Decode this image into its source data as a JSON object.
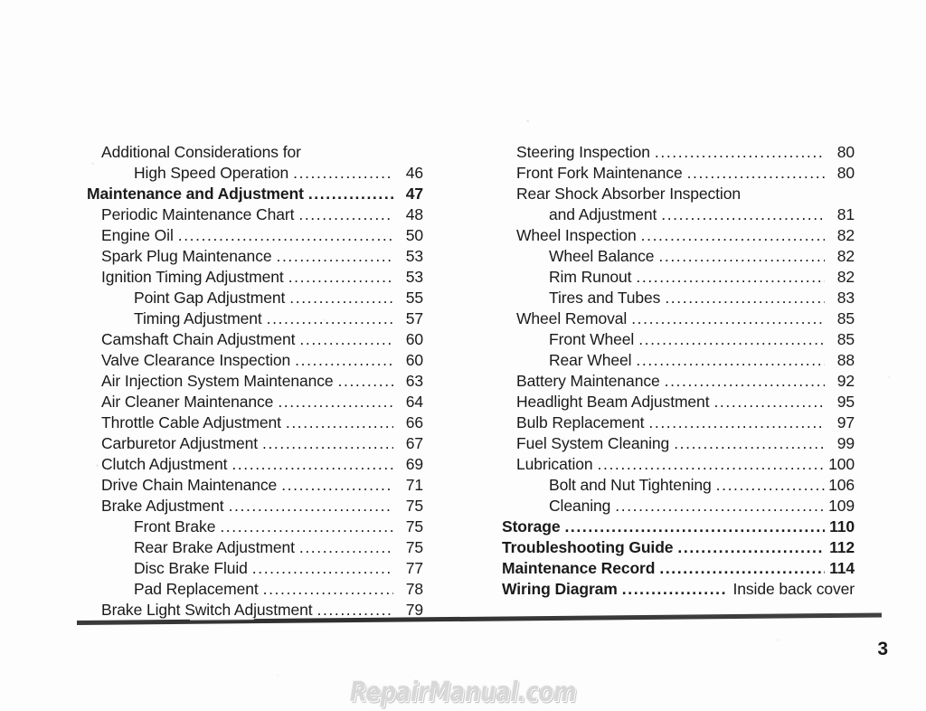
{
  "document": {
    "page_number": "3",
    "watermark": "RepairManual.com"
  },
  "toc": {
    "left_column": [
      {
        "label": "Additional Considerations for",
        "page": "",
        "level": 1,
        "leader": false
      },
      {
        "label": "High Speed Operation",
        "page": "46",
        "level": 2,
        "leader": true
      },
      {
        "label": "Maintenance and Adjustment",
        "page": "47",
        "level": 0,
        "leader": true
      },
      {
        "label": "Periodic Maintenance Chart",
        "page": "48",
        "level": 1,
        "leader": true
      },
      {
        "label": "Engine Oil",
        "page": "50",
        "level": 1,
        "leader": true
      },
      {
        "label": "Spark Plug Maintenance",
        "page": "53",
        "level": 1,
        "leader": true
      },
      {
        "label": "Ignition Timing Adjustment",
        "page": "53",
        "level": 1,
        "leader": true
      },
      {
        "label": "Point Gap Adjustment",
        "page": "55",
        "level": 2,
        "leader": true
      },
      {
        "label": "Timing Adjustment",
        "page": "57",
        "level": 2,
        "leader": true
      },
      {
        "label": "Camshaft Chain Adjustment",
        "page": "60",
        "level": 1,
        "leader": true
      },
      {
        "label": "Valve Clearance Inspection",
        "page": "60",
        "level": 1,
        "leader": true
      },
      {
        "label": "Air Injection System Maintenance",
        "page": "63",
        "level": 1,
        "leader": true
      },
      {
        "label": "Air Cleaner Maintenance",
        "page": "64",
        "level": 1,
        "leader": true
      },
      {
        "label": "Throttle Cable Adjustment",
        "page": "66",
        "level": 1,
        "leader": true
      },
      {
        "label": "Carburetor Adjustment",
        "page": "67",
        "level": 1,
        "leader": true
      },
      {
        "label": "Clutch Adjustment",
        "page": "69",
        "level": 1,
        "leader": true
      },
      {
        "label": "Drive Chain Maintenance",
        "page": "71",
        "level": 1,
        "leader": true
      },
      {
        "label": "Brake Adjustment",
        "page": "75",
        "level": 1,
        "leader": true
      },
      {
        "label": "Front Brake",
        "page": "75",
        "level": 2,
        "leader": true
      },
      {
        "label": "Rear Brake Adjustment",
        "page": "75",
        "level": 2,
        "leader": true
      },
      {
        "label": "Disc Brake Fluid",
        "page": "77",
        "level": 2,
        "leader": true
      },
      {
        "label": "Pad Replacement",
        "page": "78",
        "level": 2,
        "leader": true
      },
      {
        "label": "Brake Light Switch Adjustment",
        "page": "79",
        "level": 1,
        "leader": true
      }
    ],
    "right_column": [
      {
        "label": "Steering Inspection",
        "page": "80",
        "level": 1,
        "leader": true
      },
      {
        "label": "Front Fork Maintenance",
        "page": "80",
        "level": 1,
        "leader": true
      },
      {
        "label": "Rear Shock Absorber Inspection",
        "page": "",
        "level": 1,
        "leader": false
      },
      {
        "label": "and Adjustment",
        "page": "81",
        "level": 2,
        "leader": true
      },
      {
        "label": "Wheel Inspection",
        "page": "82",
        "level": 1,
        "leader": true
      },
      {
        "label": "Wheel Balance",
        "page": "82",
        "level": 2,
        "leader": true
      },
      {
        "label": "Rim Runout",
        "page": "82",
        "level": 2,
        "leader": true
      },
      {
        "label": "Tires and Tubes",
        "page": "83",
        "level": 2,
        "leader": true
      },
      {
        "label": "Wheel Removal",
        "page": "85",
        "level": 1,
        "leader": true
      },
      {
        "label": "Front Wheel",
        "page": "85",
        "level": 2,
        "leader": true
      },
      {
        "label": "Rear Wheel",
        "page": "88",
        "level": 2,
        "leader": true
      },
      {
        "label": "Battery Maintenance",
        "page": "92",
        "level": 1,
        "leader": true
      },
      {
        "label": "Headlight Beam Adjustment",
        "page": "95",
        "level": 1,
        "leader": true
      },
      {
        "label": "Bulb Replacement",
        "page": "97",
        "level": 1,
        "leader": true
      },
      {
        "label": "Fuel System Cleaning",
        "page": "99",
        "level": 1,
        "leader": true
      },
      {
        "label": "Lubrication",
        "page": "100",
        "level": 1,
        "leader": true
      },
      {
        "label": "Bolt and Nut Tightening",
        "page": "106",
        "level": 2,
        "leader": true
      },
      {
        "label": "Cleaning",
        "page": "109",
        "level": 2,
        "leader": true
      },
      {
        "label": "Storage",
        "page": "110",
        "level": 0,
        "leader": true
      },
      {
        "label": "Troubleshooting Guide",
        "page": "112",
        "level": 0,
        "leader": true
      },
      {
        "label": "Maintenance Record",
        "page": "114",
        "level": 0,
        "leader": true
      },
      {
        "label": "Wiring Diagram",
        "page": "Inside back cover",
        "level": 0,
        "leader": true,
        "page_is_text": true
      }
    ]
  }
}
